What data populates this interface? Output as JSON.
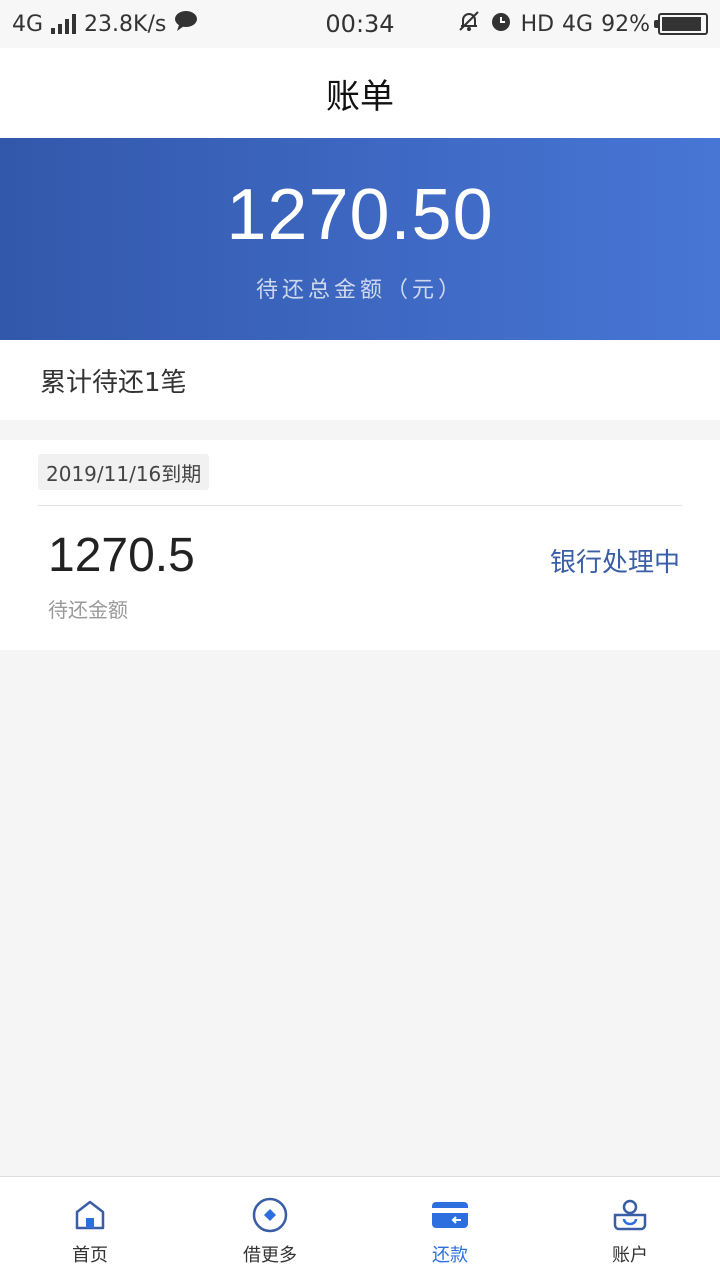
{
  "status_bar": {
    "network": "4G",
    "speed": "23.8K/s",
    "time": "00:34",
    "hd": "HD",
    "network_right": "4G",
    "battery": "92%"
  },
  "header": {
    "title": "账单"
  },
  "summary": {
    "total_amount": "1270.50",
    "total_label": "待还总金额（元）"
  },
  "count": {
    "text": "累计待还1笔"
  },
  "bill": {
    "due": "2019/11/16到期",
    "amount": "1270.5",
    "amount_label": "待还金额",
    "status": "银行处理中"
  },
  "tabs": [
    {
      "label": "首页",
      "icon": "home-icon"
    },
    {
      "label": "借更多",
      "icon": "borrow-icon"
    },
    {
      "label": "还款",
      "icon": "repay-card-icon"
    },
    {
      "label": "账户",
      "icon": "account-icon"
    }
  ],
  "colors": {
    "accent": "#2e6fe0",
    "hero_start": "#3258ab",
    "hero_end": "#4876d6",
    "status_blue": "#3a5ea5"
  }
}
